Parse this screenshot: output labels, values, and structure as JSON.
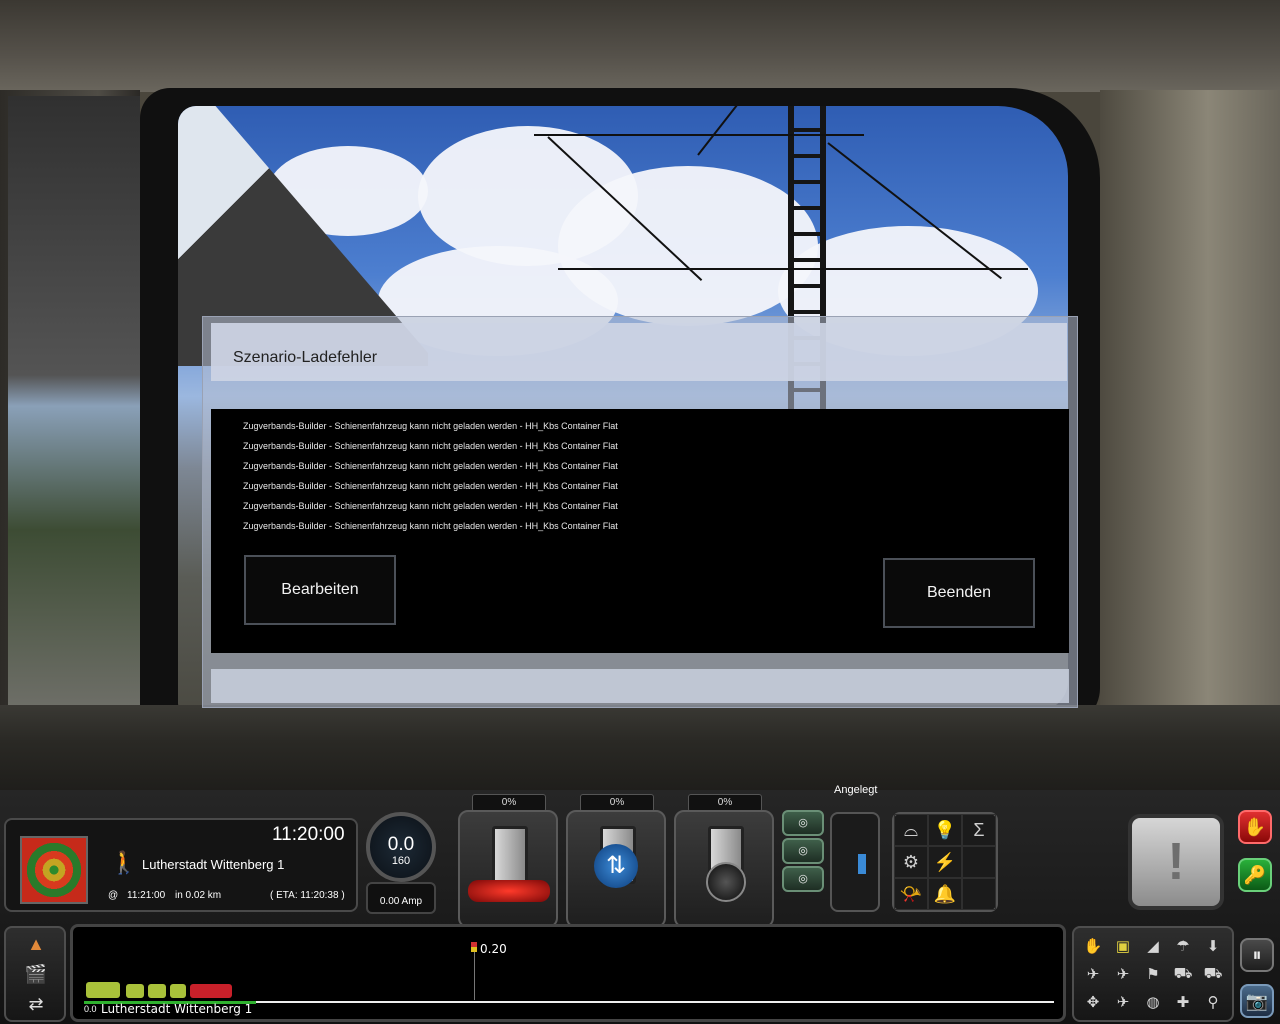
{
  "dialog": {
    "title": "Szenario-Ladefehler",
    "errors": [
      "Zugverbands-Builder - Schienenfahrzeug kann nicht geladen werden - HH_Kbs Container Flat",
      "Zugverbands-Builder - Schienenfahrzeug kann nicht geladen werden - HH_Kbs Container Flat",
      "Zugverbands-Builder - Schienenfahrzeug kann nicht geladen werden - HH_Kbs Container Flat",
      "Zugverbands-Builder - Schienenfahrzeug kann nicht geladen werden - HH_Kbs Container Flat",
      "Zugverbands-Builder - Schienenfahrzeug kann nicht geladen werden - HH_Kbs Container Flat",
      "Zugverbands-Builder - Schienenfahrzeug kann nicht geladen werden - HH_Kbs Container Flat"
    ],
    "edit_label": "Bearbeiten",
    "quit_label": "Beenden"
  },
  "hud": {
    "clock": "11:20:00",
    "destination": "Lutherstadt Wittenberg 1",
    "at_symbol": "@",
    "arrival_time": "11:21:00",
    "distance_text": "in 0.02 km",
    "eta_text": "( ETA: 11:20:38 )",
    "speed": "0.0",
    "speed_limit": "160",
    "amps": "0.00 Amp",
    "throttle_pct": "0%",
    "reverser_pct": "0%",
    "brake_pct": "0%",
    "brake_status": "Angelegt",
    "alert_symbol": "!",
    "icons": {
      "walk": "🚶",
      "reverser": "⇅",
      "horn": "📯",
      "bell": "🔔",
      "bulb": "💡",
      "wiper": "⌓",
      "stop_hand": "✋",
      "key": "🔑",
      "pause": "⏸",
      "camera": "📷"
    }
  },
  "track_monitor": {
    "start_distance": "0.0",
    "station": "Lutherstadt Wittenberg 1",
    "marker": "0.20"
  },
  "colors": {
    "dialog_body": "#000000",
    "hud_bg": "#121212",
    "track_green": "#2fb12f",
    "stop_red": "#c01818",
    "key_green": "#1c8a2a"
  }
}
